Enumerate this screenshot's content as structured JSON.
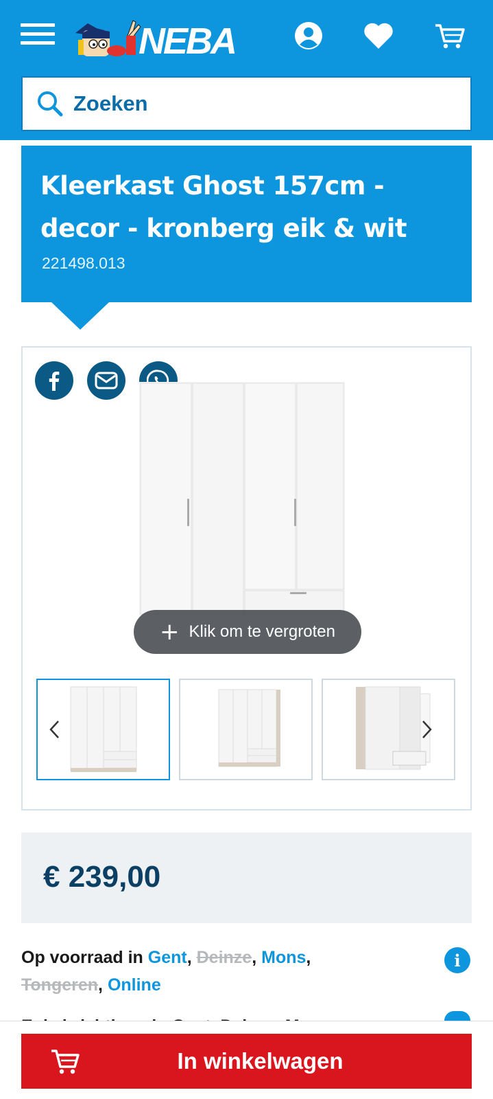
{
  "header": {
    "brand": "NEBA",
    "search_placeholder": "Zoeken",
    "colors": {
      "brand_blue": "#0d96dd",
      "dark_blue": "#0b3f64",
      "cta_red": "#d9161e"
    }
  },
  "product": {
    "title": "Kleerkast Ghost 157cm - decor - kronberg eik & wit",
    "sku": "221498.013",
    "zoom_label": "Klik om te vergroten",
    "price": "€ 239,00"
  },
  "share": {
    "icons": [
      "facebook-icon",
      "email-icon",
      "whatsapp-icon"
    ]
  },
  "stock": {
    "label": "Op voorraad in",
    "stores": [
      {
        "name": "Gent",
        "available": true
      },
      {
        "name": "Deinze",
        "available": false
      },
      {
        "name": "Mons",
        "available": true
      },
      {
        "name": "Tongeren",
        "available": false
      },
      {
        "name": "Online",
        "available": true
      }
    ],
    "next_line_partial": "Enkel zichtbaar in Gent, Deinze, Mons"
  },
  "cart": {
    "button_label": "In winkelwagen"
  }
}
